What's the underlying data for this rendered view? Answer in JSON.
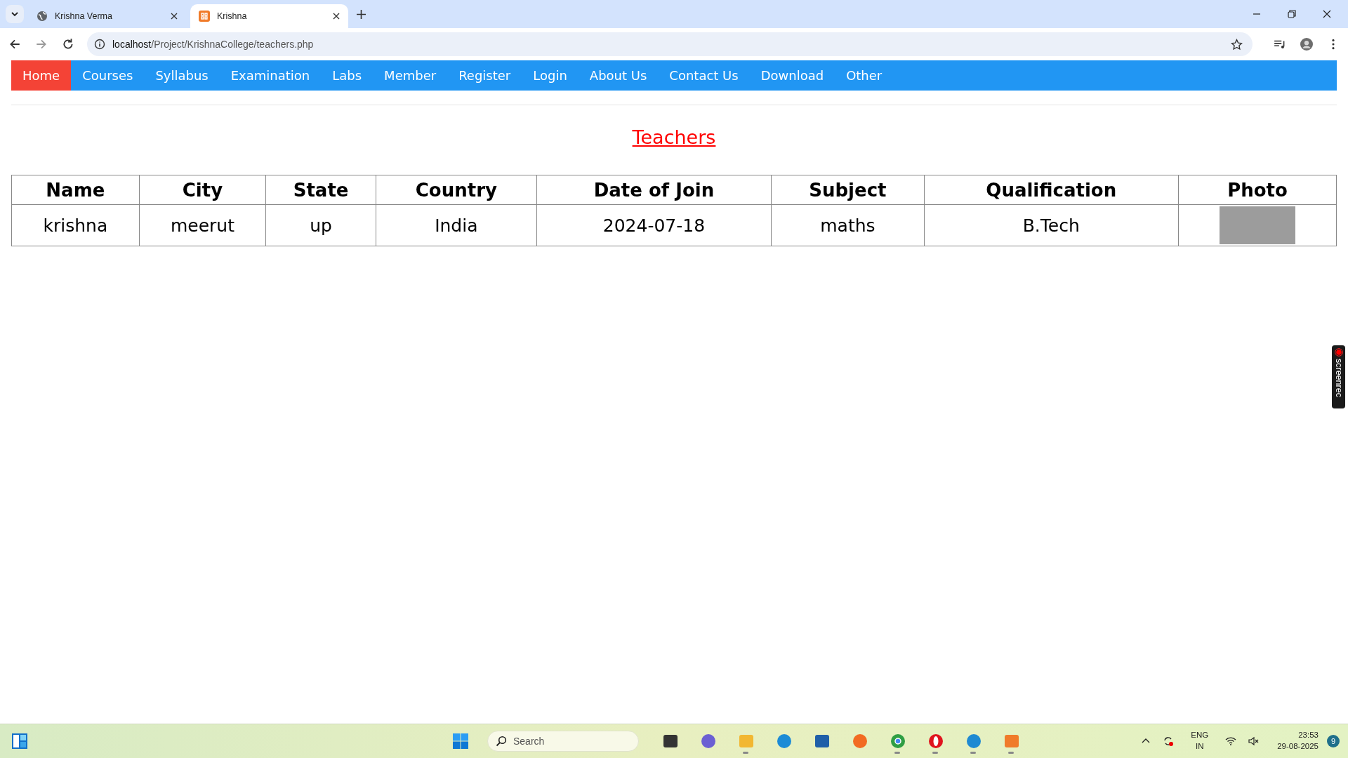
{
  "browser": {
    "tabs": [
      {
        "title": "Krishna Verma",
        "kind": "globe",
        "selected": false
      },
      {
        "title": "Krishna",
        "kind": "xampp",
        "selected": true
      }
    ],
    "address": {
      "host": "localhost",
      "path": "/Project/KrishnaCollege/teachers.php"
    }
  },
  "nav": [
    {
      "label": "Home",
      "selected": true
    },
    {
      "label": "Courses",
      "selected": false
    },
    {
      "label": "Syllabus",
      "selected": false
    },
    {
      "label": "Examination",
      "selected": false
    },
    {
      "label": "Labs",
      "selected": false
    },
    {
      "label": "Member",
      "selected": false
    },
    {
      "label": "Register",
      "selected": false
    },
    {
      "label": "Login",
      "selected": false
    },
    {
      "label": "About Us",
      "selected": false
    },
    {
      "label": "Contact Us",
      "selected": false
    },
    {
      "label": "Download",
      "selected": false
    },
    {
      "label": "Other",
      "selected": false
    }
  ],
  "heading": "Teachers",
  "table": {
    "columns": [
      "Name",
      "City",
      "State",
      "Country",
      "Date of Join",
      "Subject",
      "Qualification",
      "Photo"
    ],
    "rows": [
      {
        "cells": [
          "krishna",
          "meerut",
          "up",
          "India",
          "2024-07-18",
          "maths",
          "B.Tech"
        ],
        "photo": true
      }
    ]
  },
  "recorder_widget": {
    "label": "screenrec"
  },
  "taskbar": {
    "search": {
      "placeholder": "Search"
    },
    "apps": [
      {
        "kind": "taskview",
        "running": false
      },
      {
        "kind": "meet",
        "running": false
      },
      {
        "kind": "files",
        "running": true
      },
      {
        "kind": "edge",
        "running": false
      },
      {
        "kind": "store",
        "running": false
      },
      {
        "kind": "firefox",
        "running": false
      },
      {
        "kind": "chrome",
        "running": true
      },
      {
        "kind": "opera",
        "running": true
      },
      {
        "kind": "vscode",
        "running": true
      },
      {
        "kind": "xampp",
        "running": true
      }
    ],
    "language": [
      "ENG",
      "IN"
    ],
    "time": "23:53",
    "date": "29-08-2025",
    "notifications": "9"
  }
}
